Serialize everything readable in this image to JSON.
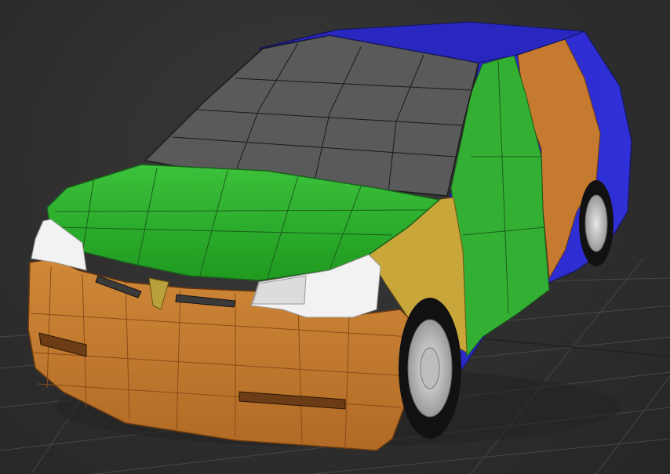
{
  "viewport": {
    "background": "#2e2e2e",
    "grid_color": "#454545"
  },
  "model": {
    "colors": {
      "roof_glass": "#5a5a5a",
      "hood": "#2fa82f",
      "side_door": "#33b033",
      "bumper": "#c57a2f",
      "fender": "#c9a63a",
      "body_edge": "#2525c8",
      "headlight": "#f2f2f2",
      "tire": "#111111",
      "rim": "#c9c9c9",
      "wire": "#1a1a1a"
    },
    "icons": [
      "car-mesh",
      "wheel",
      "headlight",
      "grille"
    ]
  }
}
